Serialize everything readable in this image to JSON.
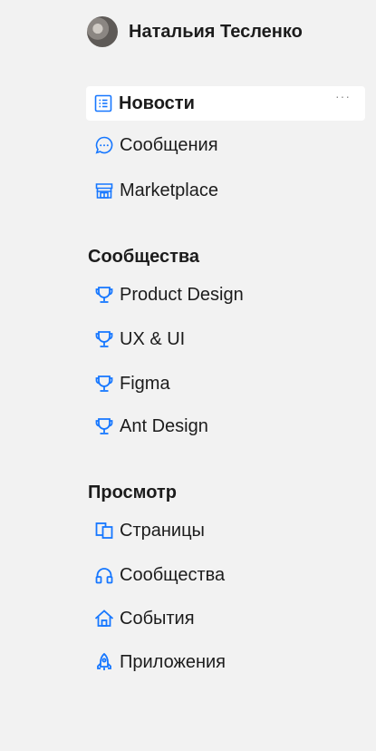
{
  "profile": {
    "name": "Натальия Тесленко"
  },
  "main_nav": [
    {
      "label": "Новости",
      "icon": "news-icon"
    },
    {
      "label": "Сообщения",
      "icon": "message-icon"
    },
    {
      "label": "Marketplace",
      "icon": "shop-icon"
    }
  ],
  "more_label": "···",
  "communities": {
    "title": "Сообщества",
    "items": [
      {
        "label": "Product Design",
        "icon": "trophy-icon"
      },
      {
        "label": "UX & UI",
        "icon": "trophy-icon"
      },
      {
        "label": "Figma",
        "icon": "trophy-icon"
      },
      {
        "label": "Ant Design",
        "icon": "trophy-icon"
      }
    ]
  },
  "browse": {
    "title": "Просмотр",
    "items": [
      {
        "label": "Страницы",
        "icon": "pages-icon"
      },
      {
        "label": "Сообщества",
        "icon": "headphones-icon"
      },
      {
        "label": "События",
        "icon": "home-icon"
      },
      {
        "label": "Приложения",
        "icon": "rocket-icon"
      }
    ]
  },
  "colors": {
    "accent": "#1677ff",
    "background": "#f2f2f2",
    "active_bg": "#ffffff"
  }
}
